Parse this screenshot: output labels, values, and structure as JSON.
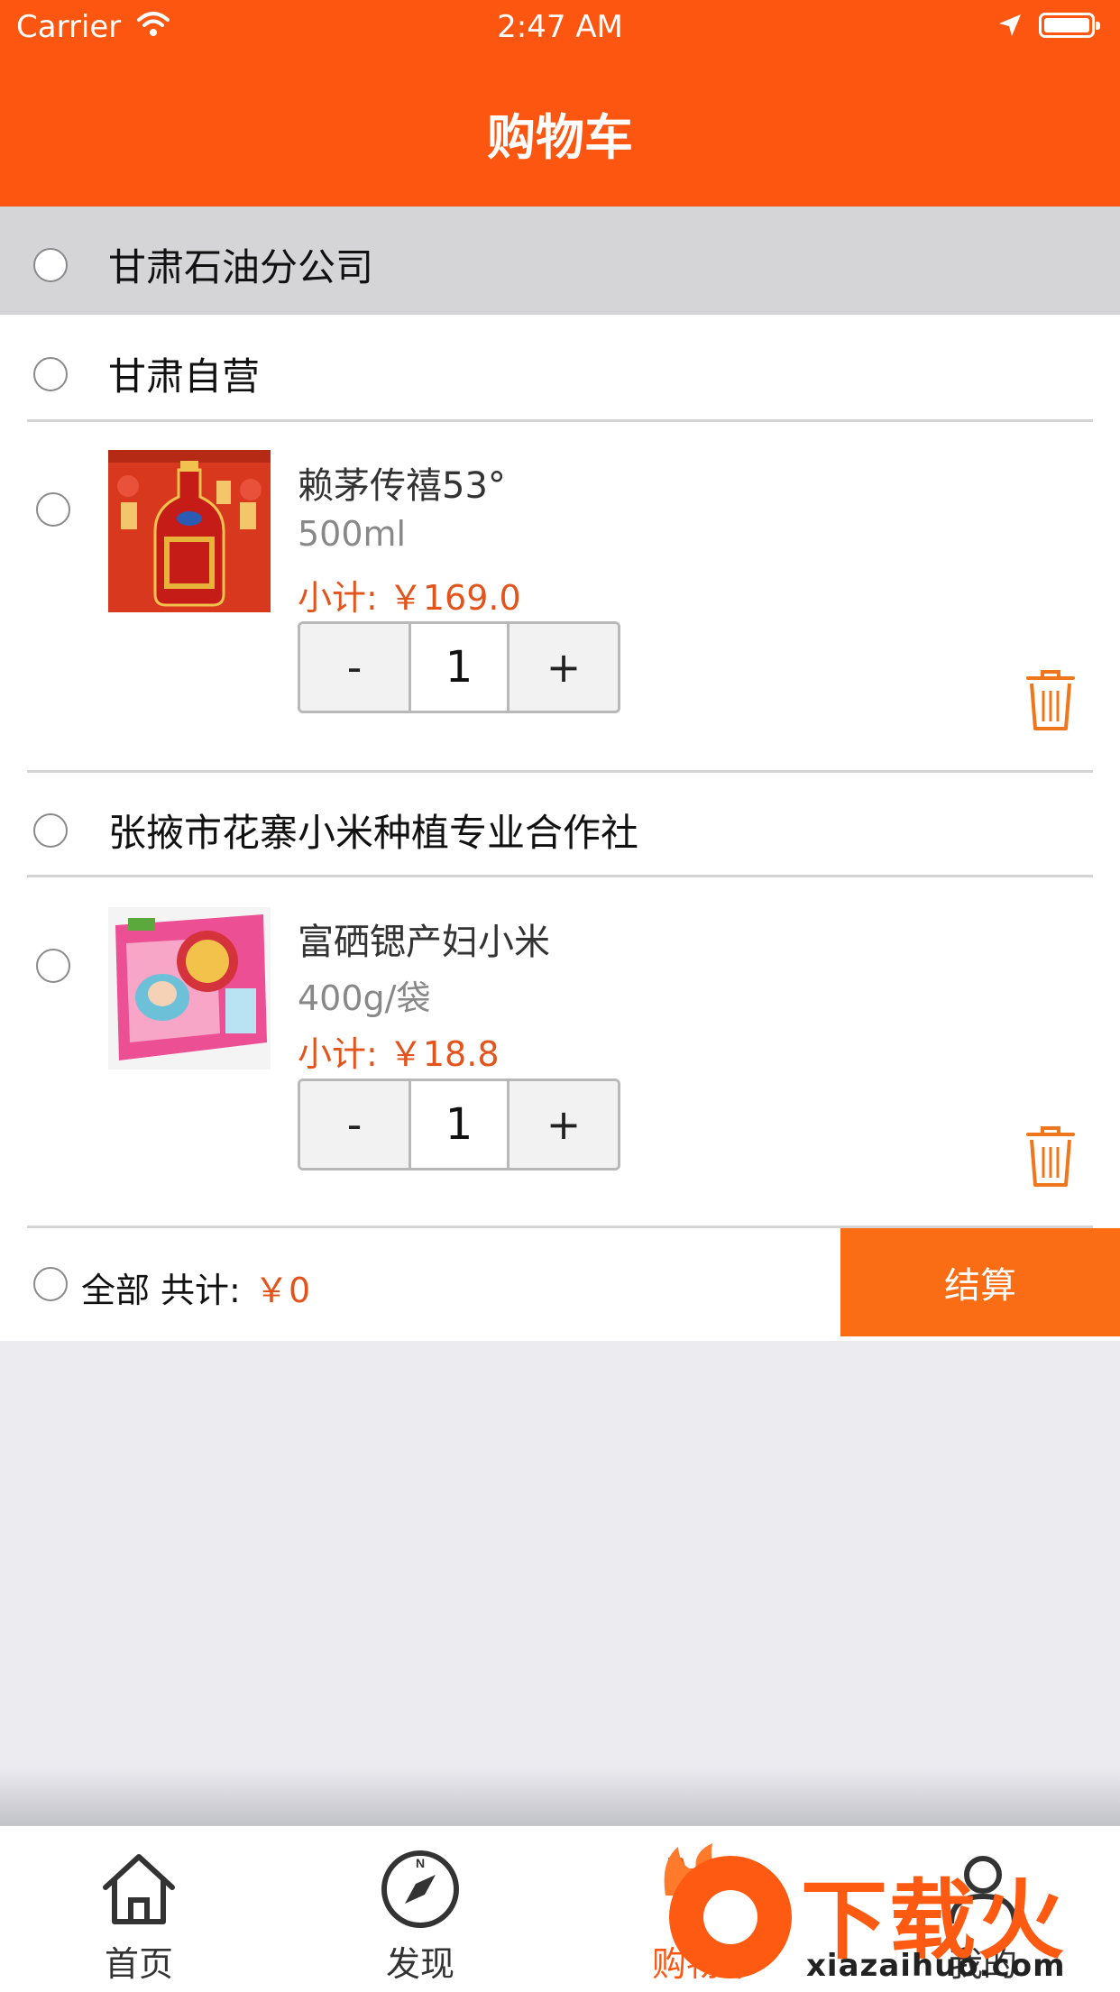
{
  "status_bar": {
    "carrier": "Carrier",
    "time": "2:47 AM"
  },
  "header": {
    "title": "购物车"
  },
  "cart": {
    "company": "甘肃石油分公司",
    "groups": [
      {
        "store_name": "甘肃自营",
        "items": [
          {
            "name": "赖茅传禧53°",
            "spec": "500ml",
            "subtotal": "小计: ￥169.0",
            "quantity": "1"
          }
        ]
      },
      {
        "store_name": "张掖市花寨小米种植专业合作社",
        "items": [
          {
            "name": "富硒锶产妇小米",
            "spec": "400g/袋",
            "subtotal": "小计: ￥18.8",
            "quantity": "1"
          }
        ]
      }
    ],
    "stepper": {
      "minus": "-",
      "plus": "+"
    }
  },
  "footer": {
    "select_all": "全部",
    "total_label": "共计:",
    "total_value": "￥0",
    "checkout": "结算"
  },
  "tabbar": {
    "tabs": [
      {
        "label": "首页",
        "icon": "home-icon"
      },
      {
        "label": "发现",
        "icon": "compass-icon"
      },
      {
        "label": "购物车",
        "icon": "cart-icon"
      },
      {
        "label": "我的",
        "icon": "profile-icon"
      }
    ]
  },
  "watermark": {
    "logo_text": "下载火",
    "url": "xiazaihuo.com"
  },
  "colors": {
    "brand_orange": "#fd5611",
    "checkout_orange": "#fb6d14",
    "price_red": "#e2541b",
    "store_header_gray": "#d5d5d8"
  }
}
